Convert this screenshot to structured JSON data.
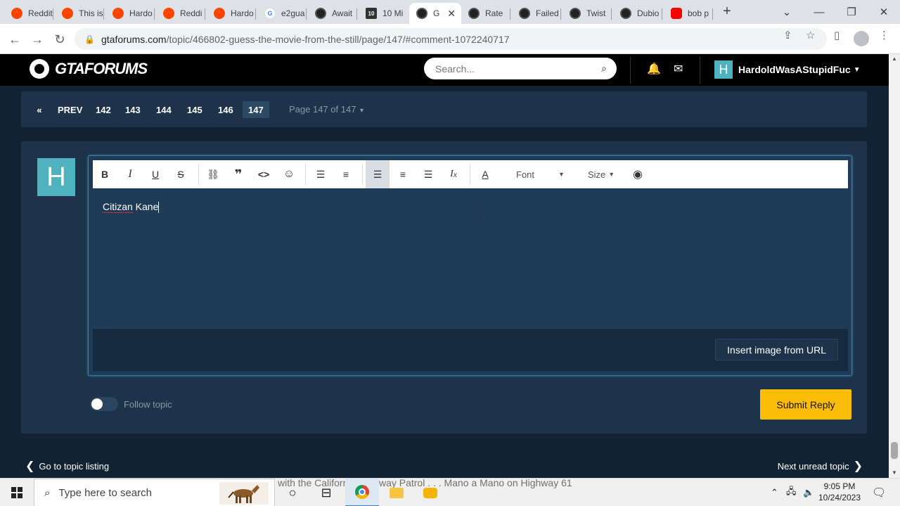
{
  "browser": {
    "tabs": [
      {
        "label": "Reddit",
        "favicon": "reddit"
      },
      {
        "label": "This is",
        "favicon": "reddit"
      },
      {
        "label": "Hardo",
        "favicon": "reddit"
      },
      {
        "label": "Reddi",
        "favicon": "reddit"
      },
      {
        "label": "Hardo",
        "favicon": "reddit"
      },
      {
        "label": "e2gua",
        "favicon": "google"
      },
      {
        "label": "Await",
        "favicon": "gta"
      },
      {
        "label": "10 Mi",
        "favicon": "ten"
      },
      {
        "label": "G",
        "favicon": "gta",
        "active": true
      },
      {
        "label": "Rate",
        "favicon": "gta"
      },
      {
        "label": "Failed",
        "favicon": "gta"
      },
      {
        "label": "Twist",
        "favicon": "gta"
      },
      {
        "label": "Dubio",
        "favicon": "gta"
      },
      {
        "label": "bob p",
        "favicon": "youtube"
      }
    ],
    "url_host": "gtaforums.com",
    "url_path": "/topic/466802-guess-the-movie-from-the-still/page/147/#comment-1072240717"
  },
  "site": {
    "logo_text": "GTAFORUMS",
    "search_placeholder": "Search...",
    "username": "HardoldWasAStupidFuc",
    "avatar_letter": "H"
  },
  "pagination": {
    "prev_label": "PREV",
    "pages": [
      "142",
      "143",
      "144",
      "145",
      "146",
      "147"
    ],
    "current": "147",
    "page_info": "Page 147 of 147"
  },
  "editor": {
    "avatar_letter": "H",
    "font_label": "Font",
    "size_label": "Size",
    "text_before": "Citizan",
    "text_after": " Kane",
    "insert_image_label": "Insert image from URL"
  },
  "follow_label": "Follow topic",
  "submit_label": "Submit Reply",
  "nav": {
    "back_label": "Go to topic listing",
    "next_label": "Next unread topic"
  },
  "taskbar": {
    "search_placeholder": "Type here to search",
    "ticker": "with the California Highway Patrol . . . Mano a Mano on Highway 61",
    "time": "9:05 PM",
    "date": "10/24/2023"
  },
  "colors": {
    "accent": "#fbbd08",
    "avatar": "#4fb3bf",
    "panel": "#1c3349",
    "background": "#112233"
  }
}
